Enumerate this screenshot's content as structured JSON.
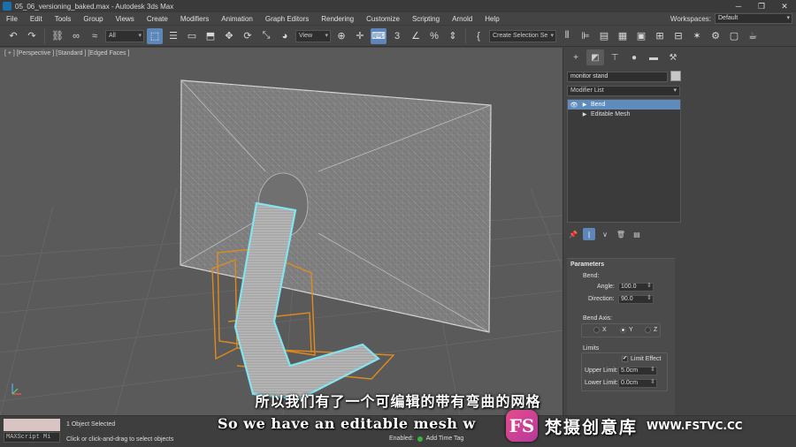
{
  "window": {
    "title": "05_06_versioning_baked.max - Autodesk 3ds Max",
    "controls": [
      "minimize-icon",
      "restore-icon",
      "close-icon"
    ]
  },
  "menubar": {
    "items": [
      "File",
      "Edit",
      "Tools",
      "Group",
      "Views",
      "Create",
      "Modifiers",
      "Animation",
      "Graph Editors",
      "Rendering",
      "Customize",
      "Scripting",
      "Arnold",
      "Help"
    ],
    "workspaces_label": "Workspaces:",
    "workspaces_value": "Default"
  },
  "toolbar": {
    "selection_filter": "All",
    "reference_coord": "View",
    "named_selection": "Create Selection Se"
  },
  "viewport": {
    "label": "[ + ] [Perspective ] [Standard ] [Edged Faces ]",
    "background": "#5a5a5a",
    "wire_color": "#cfcfcf",
    "selection_color": "#7fe3f0",
    "gizmo_color": "#e08a1e"
  },
  "command_panel": {
    "object_name": "monitor stand",
    "modifier_list": "Modifier List",
    "stack": [
      {
        "label": "Bend",
        "selected": true
      },
      {
        "label": "Editable Mesh",
        "selected": false
      }
    ],
    "parameters": {
      "title": "Parameters",
      "bend_label": "Bend:",
      "angle_label": "Angle:",
      "angle_value": "100.0",
      "direction_label": "Direction:",
      "direction_value": "90.0",
      "bend_axis_label": "Bend Axis:",
      "axes": [
        "X",
        "Y",
        "Z"
      ],
      "selected_axis": "Y",
      "limits_label": "Limits",
      "limit_effect_label": "Limit Effect",
      "limit_effect_checked": true,
      "upper_limit_label": "Upper Limit:",
      "upper_limit_value": "5.0cm",
      "lower_limit_label": "Lower Limit:",
      "lower_limit_value": "0.0cm"
    }
  },
  "statusbar": {
    "maxscript_label": "MAXScript Mi",
    "selection_status": "1 Object Selected",
    "prompt": "Click or click-and-drag to select objects",
    "enabled_label": "Enabled:",
    "add_time_tag": "Add Time Tag"
  },
  "overlay": {
    "subtitle_cn": "所以我们有了一个可编辑的带有弯曲的网格",
    "subtitle_en": "So we have an editable mesh w",
    "watermark_logo": "FS",
    "watermark_cn": "梵摄创意库",
    "watermark_url": "WWW.FSTVC.CC"
  }
}
